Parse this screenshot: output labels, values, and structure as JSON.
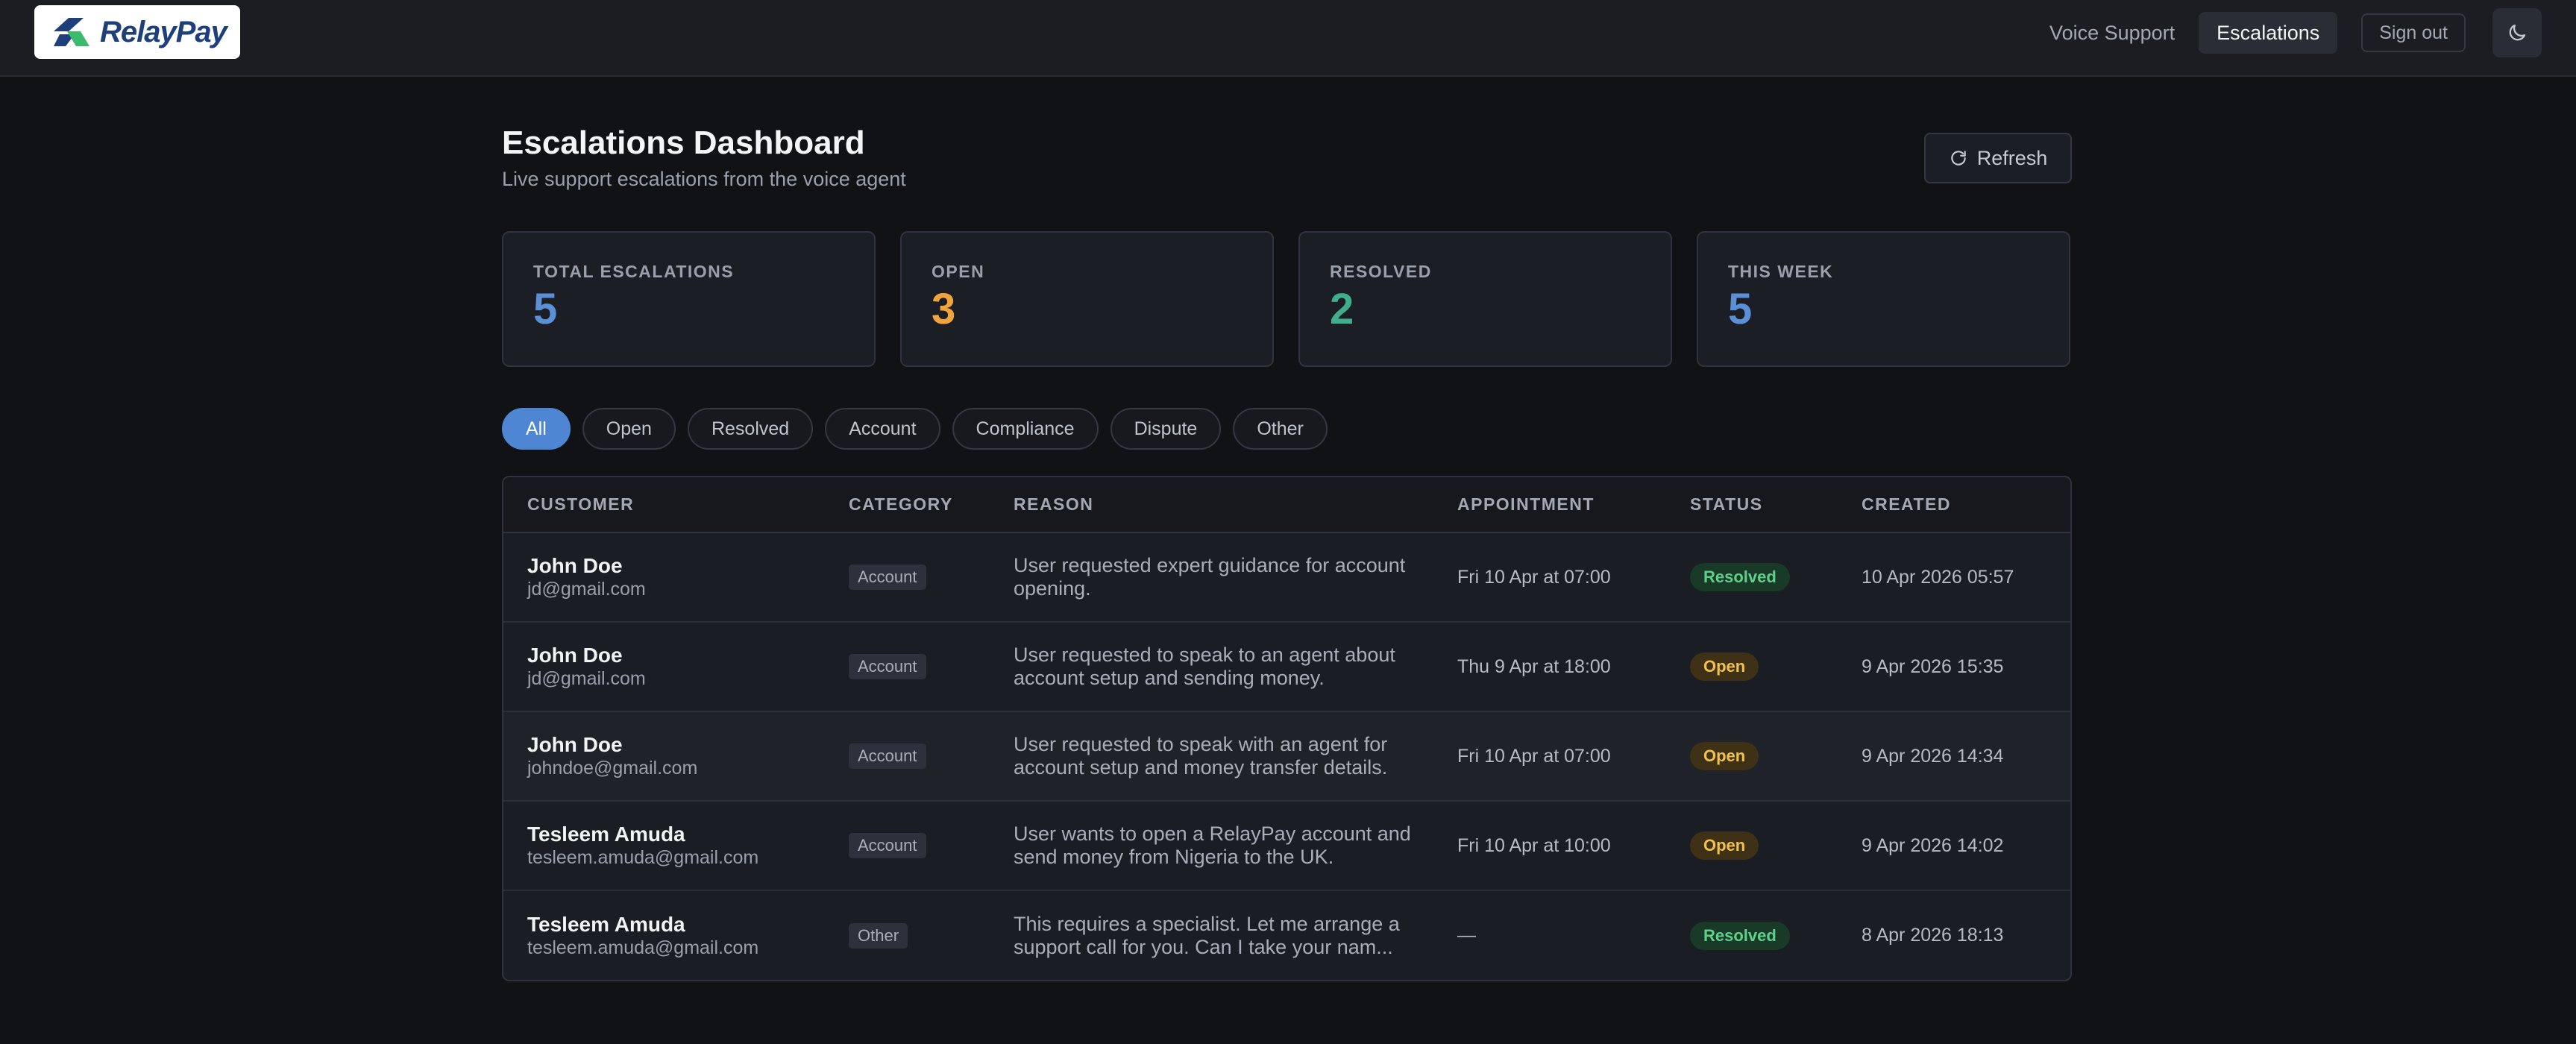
{
  "brand": {
    "name": "RelayPay"
  },
  "nav": {
    "links": [
      {
        "label": "Voice Support",
        "active": false
      },
      {
        "label": "Escalations",
        "active": true
      }
    ],
    "signout_label": "Sign out",
    "theme_icon": "moon-icon"
  },
  "page": {
    "title": "Escalations Dashboard",
    "subtitle": "Live support escalations from the voice agent",
    "refresh_label": "Refresh"
  },
  "stats": [
    {
      "label": "TOTAL ESCALATIONS",
      "value": "5",
      "color": "#5b8fd6"
    },
    {
      "label": "OPEN",
      "value": "3",
      "color": "#f0a53c"
    },
    {
      "label": "RESOLVED",
      "value": "2",
      "color": "#3fae8c"
    },
    {
      "label": "THIS WEEK",
      "value": "5",
      "color": "#5b8fd6"
    }
  ],
  "filters": [
    "All",
    "Open",
    "Resolved",
    "Account",
    "Compliance",
    "Dispute",
    "Other"
  ],
  "active_filter": "All",
  "table": {
    "columns": [
      "CUSTOMER",
      "CATEGORY",
      "REASON",
      "APPOINTMENT",
      "STATUS",
      "CREATED"
    ],
    "rows": [
      {
        "name": "John Doe",
        "email": "jd@gmail.com",
        "category": "Account",
        "reason": "User requested expert guidance for account opening.",
        "appointment": "Fri 10 Apr at 07:00",
        "status": "Resolved",
        "created": "10 Apr 2026 05:57"
      },
      {
        "name": "John Doe",
        "email": "jd@gmail.com",
        "category": "Account",
        "reason": "User requested to speak to an agent about account setup and sending money.",
        "appointment": "Thu 9 Apr at 18:00",
        "status": "Open",
        "created": "9 Apr 2026 15:35"
      },
      {
        "name": "John Doe",
        "email": "johndoe@gmail.com",
        "category": "Account",
        "reason": "User requested to speak with an agent for account setup and money transfer details.",
        "appointment": "Fri 10 Apr at 07:00",
        "status": "Open",
        "created": "9 Apr 2026 14:34"
      },
      {
        "name": "Tesleem Amuda",
        "email": "tesleem.amuda@gmail.com",
        "category": "Account",
        "reason": "User wants to open a RelayPay account and send money from Nigeria to the UK.",
        "appointment": "Fri 10 Apr at 10:00",
        "status": "Open",
        "created": "9 Apr 2026 14:02"
      },
      {
        "name": "Tesleem Amuda",
        "email": "tesleem.amuda@gmail.com",
        "category": "Other",
        "reason": "This requires a specialist. Let me arrange a support call for you. Can I take your nam...",
        "appointment": "—",
        "status": "Resolved",
        "created": "8 Apr 2026 18:13"
      }
    ]
  }
}
